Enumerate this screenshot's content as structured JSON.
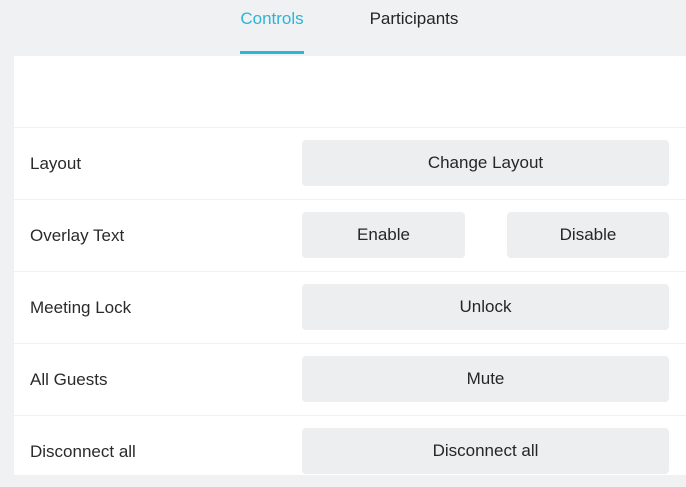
{
  "tabs": {
    "controls": "Controls",
    "participants": "Participants"
  },
  "colors": {
    "accent": "#2bb5d8",
    "button_bg": "#eceeef",
    "page_bg": "#f0f1f2"
  },
  "rows": {
    "layout": {
      "label": "Layout",
      "button": "Change Layout"
    },
    "overlay_text": {
      "label": "Overlay Text",
      "enable": "Enable",
      "disable": "Disable"
    },
    "meeting_lock": {
      "label": "Meeting Lock",
      "button": "Unlock"
    },
    "all_guests": {
      "label": "All Guests",
      "button": "Mute"
    },
    "disconnect_all": {
      "label": "Disconnect all",
      "button": "Disconnect all"
    }
  }
}
